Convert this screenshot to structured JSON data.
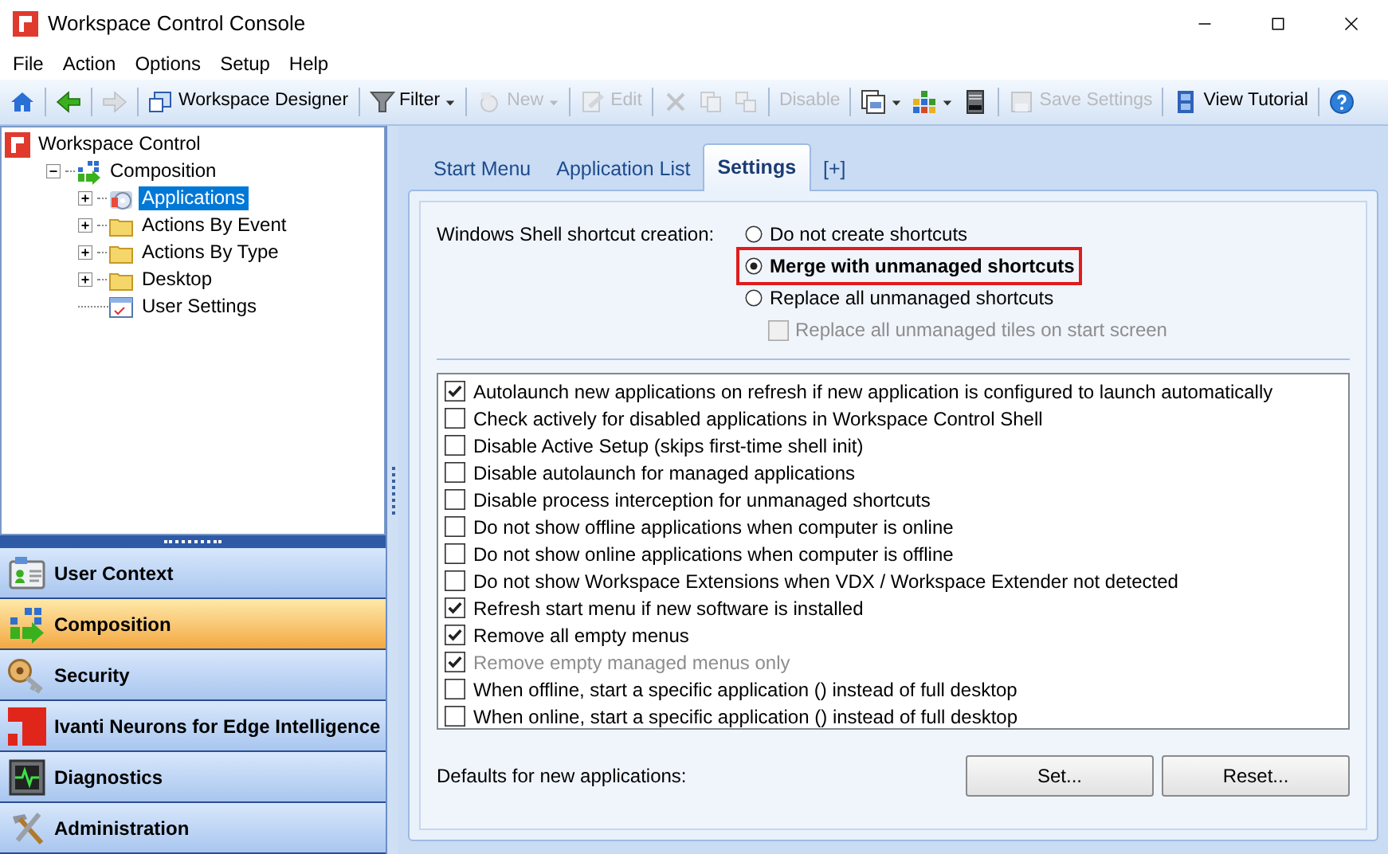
{
  "window": {
    "title": "Workspace Control Console"
  },
  "menu": [
    "File",
    "Action",
    "Options",
    "Setup",
    "Help"
  ],
  "toolbar": [
    {
      "kind": "home",
      "disabled": false
    },
    {
      "kind": "separator"
    },
    {
      "kind": "back",
      "disabled": false
    },
    {
      "kind": "separator"
    },
    {
      "kind": "forward",
      "disabled": true
    },
    {
      "kind": "separator"
    },
    {
      "kind": "designer",
      "label": "Workspace Designer",
      "disabled": false
    },
    {
      "kind": "separator"
    },
    {
      "kind": "filter",
      "label": "Filter",
      "dropdown": true,
      "disabled": false
    },
    {
      "kind": "separator"
    },
    {
      "kind": "new",
      "label": "New",
      "dropdown": true,
      "disabled": true
    },
    {
      "kind": "separator"
    },
    {
      "kind": "edit",
      "label": "Edit",
      "disabled": true
    },
    {
      "kind": "separator"
    },
    {
      "kind": "delete",
      "disabled": true
    },
    {
      "kind": "copy",
      "disabled": true
    },
    {
      "kind": "duplicate",
      "disabled": true
    },
    {
      "kind": "separator"
    },
    {
      "kind": "text",
      "label": "Disable",
      "disabled": true
    },
    {
      "kind": "separator"
    },
    {
      "kind": "views",
      "dropdown": true,
      "disabled": false
    },
    {
      "kind": "blocks",
      "dropdown": true,
      "disabled": false
    },
    {
      "kind": "server",
      "disabled": false
    },
    {
      "kind": "separator"
    },
    {
      "kind": "save",
      "label": "Save Settings",
      "disabled": true
    },
    {
      "kind": "separator"
    },
    {
      "kind": "film",
      "label": "View Tutorial",
      "disabled": false
    },
    {
      "kind": "separator"
    },
    {
      "kind": "help",
      "disabled": false
    }
  ],
  "tree": [
    {
      "label": "Workspace Control",
      "kind": "root",
      "selected": false,
      "children": [
        {
          "label": "Composition",
          "kind": "composition",
          "expanded": true,
          "selected": false,
          "children": [
            {
              "label": "Applications",
              "kind": "applications",
              "expanded": false,
              "selected": true
            },
            {
              "label": "Actions By Event",
              "kind": "folder",
              "expanded": false,
              "selected": false
            },
            {
              "label": "Actions By Type",
              "kind": "folder",
              "expanded": false,
              "selected": false
            },
            {
              "label": "Desktop",
              "kind": "folder",
              "expanded": false,
              "selected": false
            },
            {
              "label": "User Settings",
              "kind": "settings",
              "selected": false
            }
          ]
        }
      ]
    }
  ],
  "nav": [
    {
      "label": "User Context",
      "kind": "user",
      "selected": false
    },
    {
      "label": "Composition",
      "kind": "composition",
      "selected": true
    },
    {
      "label": "Security",
      "kind": "key",
      "selected": false
    },
    {
      "label": "Ivanti Neurons for Edge Intelligence",
      "kind": "logo",
      "selected": false
    },
    {
      "label": "Diagnostics",
      "kind": "monitor",
      "selected": false
    },
    {
      "label": "Administration",
      "kind": "tools",
      "selected": false
    }
  ],
  "tabs": [
    {
      "label": "Start Menu",
      "selected": false
    },
    {
      "label": "Application List",
      "selected": false
    },
    {
      "label": "Settings",
      "selected": true
    },
    {
      "label": "[+]",
      "selected": false
    }
  ],
  "shortcut_creation": {
    "label": "Windows Shell shortcut creation:",
    "options": [
      {
        "label": "Do not create shortcuts",
        "selected": false,
        "highlighted": false
      },
      {
        "label": "Merge with unmanaged shortcuts",
        "selected": true,
        "highlighted": true
      },
      {
        "label": "Replace all unmanaged shortcuts",
        "selected": false,
        "highlighted": false
      }
    ],
    "sub_option": {
      "label": "Replace all unmanaged tiles on start screen",
      "checked": false,
      "disabled": true
    }
  },
  "options": [
    {
      "label": "Autolaunch new applications on refresh if new application is configured to launch automatically",
      "checked": true,
      "disabled": false
    },
    {
      "label": "Check actively for disabled applications in Workspace Control Shell",
      "checked": false,
      "disabled": false
    },
    {
      "label": "Disable Active Setup (skips first-time shell init)",
      "checked": false,
      "disabled": false
    },
    {
      "label": "Disable autolaunch for managed applications",
      "checked": false,
      "disabled": false
    },
    {
      "label": "Disable process interception for unmanaged shortcuts",
      "checked": false,
      "disabled": false
    },
    {
      "label": "Do not show offline applications when computer is online",
      "checked": false,
      "disabled": false
    },
    {
      "label": "Do not show online applications when computer is offline",
      "checked": false,
      "disabled": false
    },
    {
      "label": "Do not show Workspace Extensions when VDX / Workspace Extender not detected",
      "checked": false,
      "disabled": false
    },
    {
      "label": "Refresh start menu if new software is installed",
      "checked": true,
      "disabled": false
    },
    {
      "label": "Remove all empty menus",
      "checked": true,
      "disabled": false
    },
    {
      "label": "Remove empty managed menus only",
      "checked": true,
      "disabled": true
    },
    {
      "label": "When offline, start a specific application () instead of full desktop",
      "checked": false,
      "disabled": false
    },
    {
      "label": "When online, start a specific application () instead of full desktop",
      "checked": false,
      "disabled": false
    }
  ],
  "defaults": {
    "label": "Defaults for new applications:",
    "buttons": [
      "Set...",
      "Reset..."
    ]
  }
}
